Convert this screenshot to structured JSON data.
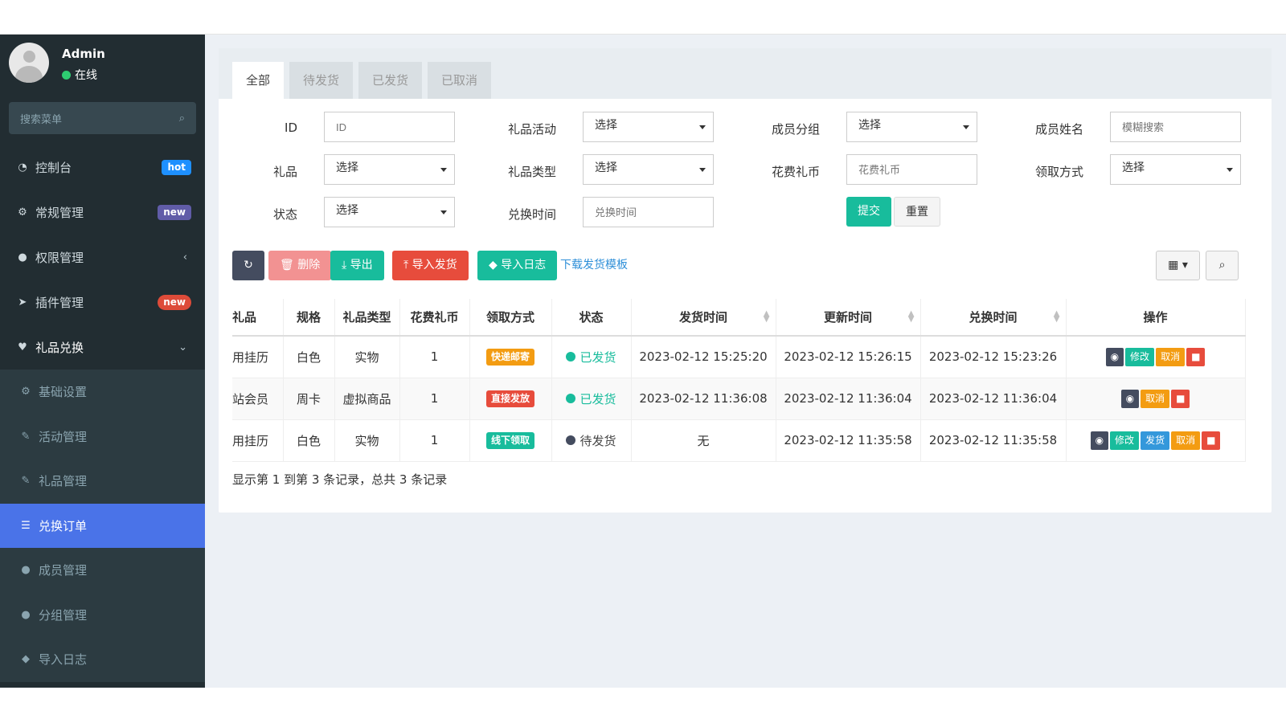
{
  "user": {
    "name": "Admin",
    "status": "在线"
  },
  "sidebar": {
    "search_placeholder": "搜索菜单",
    "items": [
      {
        "label": "控制台",
        "icon": "dashboard-icon",
        "badge": "hot"
      },
      {
        "label": "常规管理",
        "icon": "cogs-icon",
        "badge": "new"
      },
      {
        "label": "权限管理",
        "icon": "users-icon"
      },
      {
        "label": "插件管理",
        "icon": "rocket-icon",
        "badge": "new"
      },
      {
        "label": "礼品兑换",
        "icon": "heart-icon"
      }
    ],
    "subitems": [
      {
        "label": "基础设置",
        "icon": "cogs-icon"
      },
      {
        "label": "活动管理",
        "icon": "leaf-icon"
      },
      {
        "label": "礼品管理",
        "icon": "leaf-icon"
      },
      {
        "label": "兑换订单",
        "icon": "list-icon"
      },
      {
        "label": "成员管理",
        "icon": "user-icon"
      },
      {
        "label": "分组管理",
        "icon": "users-icon"
      },
      {
        "label": "导入日志",
        "icon": "tint-icon"
      }
    ]
  },
  "tabs": [
    "全部",
    "待发货",
    "已发货",
    "已取消"
  ],
  "form": {
    "id_label": "ID",
    "id_placeholder": "ID",
    "activity_label": "礼品活动",
    "activity_value": "选择",
    "group_label": "成员分组",
    "group_value": "选择",
    "member_label": "成员姓名",
    "member_placeholder": "模糊搜索",
    "gift_label": "礼品",
    "gift_value": "选择",
    "gifttype_label": "礼品类型",
    "gifttype_value": "选择",
    "coin_label": "花费礼币",
    "coin_placeholder": "花费礼币",
    "method_label": "领取方式",
    "method_value": "选择",
    "status_label": "状态",
    "status_value": "选择",
    "time_label": "兑换时间",
    "time_placeholder": "兑换时间",
    "submit": "提交",
    "reset": "重置"
  },
  "toolbar": {
    "delete": "删除",
    "export": "导出",
    "import_ship": "导入发货",
    "import_log": "导入日志",
    "download_template": "下载发货模板"
  },
  "table": {
    "headers": [
      "礼品",
      "规格",
      "礼品类型",
      "花费礼币",
      "领取方式",
      "状态",
      "发货时间",
      "更新时间",
      "兑换时间",
      "操作"
    ],
    "rows": [
      {
        "gift": "用挂历",
        "spec": "白色",
        "type": "实物",
        "coin": "1",
        "method": "快递邮寄",
        "status": "已发货",
        "ship_time": "2023-02-12 15:25:20",
        "update_time": "2023-02-12 15:26:15",
        "exchange_time": "2023-02-12 15:23:26",
        "actions": [
          "修改",
          "取消"
        ]
      },
      {
        "gift": "站会员",
        "spec": "周卡",
        "type": "虚拟商品",
        "coin": "1",
        "method": "直接发放",
        "status": "已发货",
        "ship_time": "2023-02-12 11:36:08",
        "update_time": "2023-02-12 11:36:04",
        "exchange_time": "2023-02-12 11:36:04",
        "actions": [
          "取消"
        ]
      },
      {
        "gift": "用挂历",
        "spec": "白色",
        "type": "实物",
        "coin": "1",
        "method": "线下领取",
        "status": "待发货",
        "ship_time": "无",
        "update_time": "2023-02-12 11:35:58",
        "exchange_time": "2023-02-12 11:35:58",
        "actions": [
          "修改",
          "发货",
          "取消"
        ]
      }
    ]
  },
  "pagination": "显示第 1 到第 3 条记录，总共 3 条记录",
  "colors": {
    "sidebar": "#222d32",
    "active": "#4a73e8",
    "success": "#18bc9c",
    "danger": "#e74c3c",
    "warning": "#f39c12"
  }
}
